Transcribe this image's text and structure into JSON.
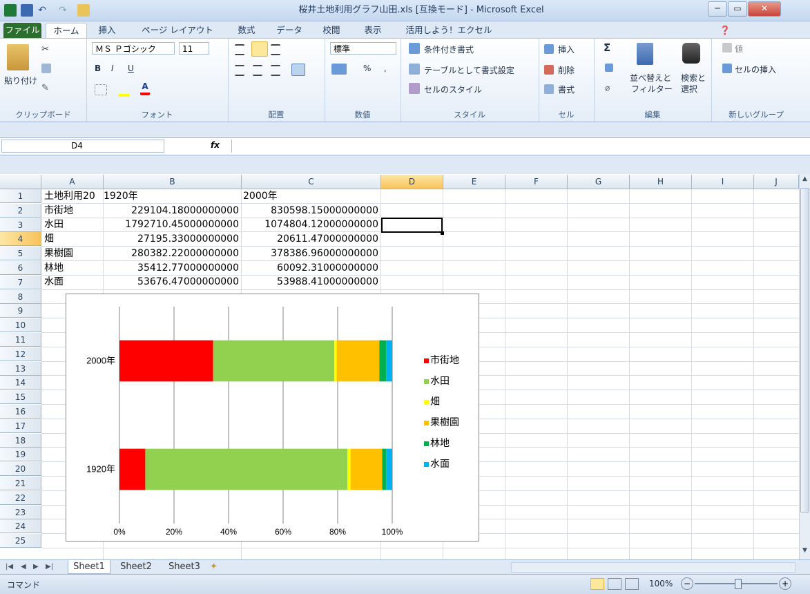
{
  "window": {
    "title": "桜井土地利用グラフ山田.xls [互換モード] - Microsoft Excel",
    "minimize": "─",
    "restore": "▭",
    "close": "✕"
  },
  "tabs": [
    "ファイル",
    "ホーム",
    "挿入",
    "ページ レイアウト",
    "数式",
    "データ",
    "校閲",
    "表示",
    "活用しよう！エクセル"
  ],
  "ribbon": {
    "clipboard": {
      "name": "クリップボード",
      "paste": "貼り付け"
    },
    "font": {
      "name": "フォント",
      "font_name": "ＭＳ Ｐゴシック",
      "font_size": "11",
      "bold": "B",
      "italic": "I",
      "underline": "U"
    },
    "alignment": {
      "name": "配置"
    },
    "number": {
      "name": "数値",
      "format": "標準",
      "percent": "%",
      "comma": ","
    },
    "styles": {
      "name": "スタイル",
      "conditional": "条件付き書式",
      "table": "テーブルとして書式設定",
      "cell_styles": "セルのスタイル"
    },
    "cells": {
      "name": "セル",
      "insert": "挿入",
      "delete": "削除",
      "format": "書式"
    },
    "editing": {
      "name": "編集",
      "sum": "Σ",
      "sort": "並べ替えと",
      "sort2": "フィルター",
      "find": "検索と",
      "find2": "選択"
    },
    "newgroup": {
      "name": "新しいグループ",
      "values": "値",
      "insert_cells": "セルの挿入"
    }
  },
  "formula_bar": {
    "name_box": "D4",
    "fx": "fx",
    "value": ""
  },
  "columns": [
    "A",
    "B",
    "C",
    "D",
    "E",
    "F",
    "G",
    "H",
    "I",
    "J"
  ],
  "rows": [
    "1",
    "2",
    "3",
    "4",
    "5",
    "6",
    "7",
    "8",
    "9",
    "10",
    "11",
    "12",
    "13",
    "14",
    "15",
    "16",
    "17",
    "18",
    "19",
    "20",
    "21",
    "22",
    "23",
    "24",
    "25"
  ],
  "cells": {
    "A1": "土地利用20",
    "B1": "1920年",
    "C1": "2000年",
    "A2": "市街地",
    "B2": "229104.18000000000",
    "C2": "830598.15000000000",
    "A3": "水田",
    "B3": "1792710.45000000000",
    "C3": "1074804.12000000000",
    "A4": "畑",
    "B4": "27195.33000000000",
    "C4": "20611.47000000000",
    "A5": "果樹園",
    "B5": "280382.22000000000",
    "C5": "378386.96000000000",
    "A6": "林地",
    "B6": "35412.77000000000",
    "C6": "60092.31000000000",
    "A7": "水面",
    "B7": "53676.47000000000",
    "C7": "53988.41000000000"
  },
  "chart_data": {
    "type": "bar",
    "stacked": "percent",
    "orientation": "horizontal",
    "categories": [
      "2000年",
      "1920年"
    ],
    "series": [
      {
        "name": "市街地",
        "color": "#ff0000",
        "values": [
          830598.15,
          229104.18
        ]
      },
      {
        "name": "水田",
        "color": "#92d050",
        "values": [
          1074804.12,
          1792710.45
        ]
      },
      {
        "name": "畑",
        "color": "#ffff00",
        "values": [
          20611.47,
          27195.33
        ]
      },
      {
        "name": "果樹園",
        "color": "#ffc000",
        "values": [
          378386.96,
          280382.22
        ]
      },
      {
        "name": "林地",
        "color": "#00b050",
        "values": [
          60092.31,
          35412.77
        ]
      },
      {
        "name": "水面",
        "color": "#00b0f0",
        "values": [
          53988.41,
          53676.47
        ]
      }
    ],
    "xticks": [
      "0%",
      "20%",
      "40%",
      "60%",
      "80%",
      "100%"
    ],
    "xlim": [
      0,
      100
    ],
    "grid": true,
    "legend_position": "right",
    "title": ""
  },
  "sheets": [
    "Sheet1",
    "Sheet2",
    "Sheet3"
  ],
  "status": {
    "mode": "コマンド",
    "zoom": "100%"
  }
}
